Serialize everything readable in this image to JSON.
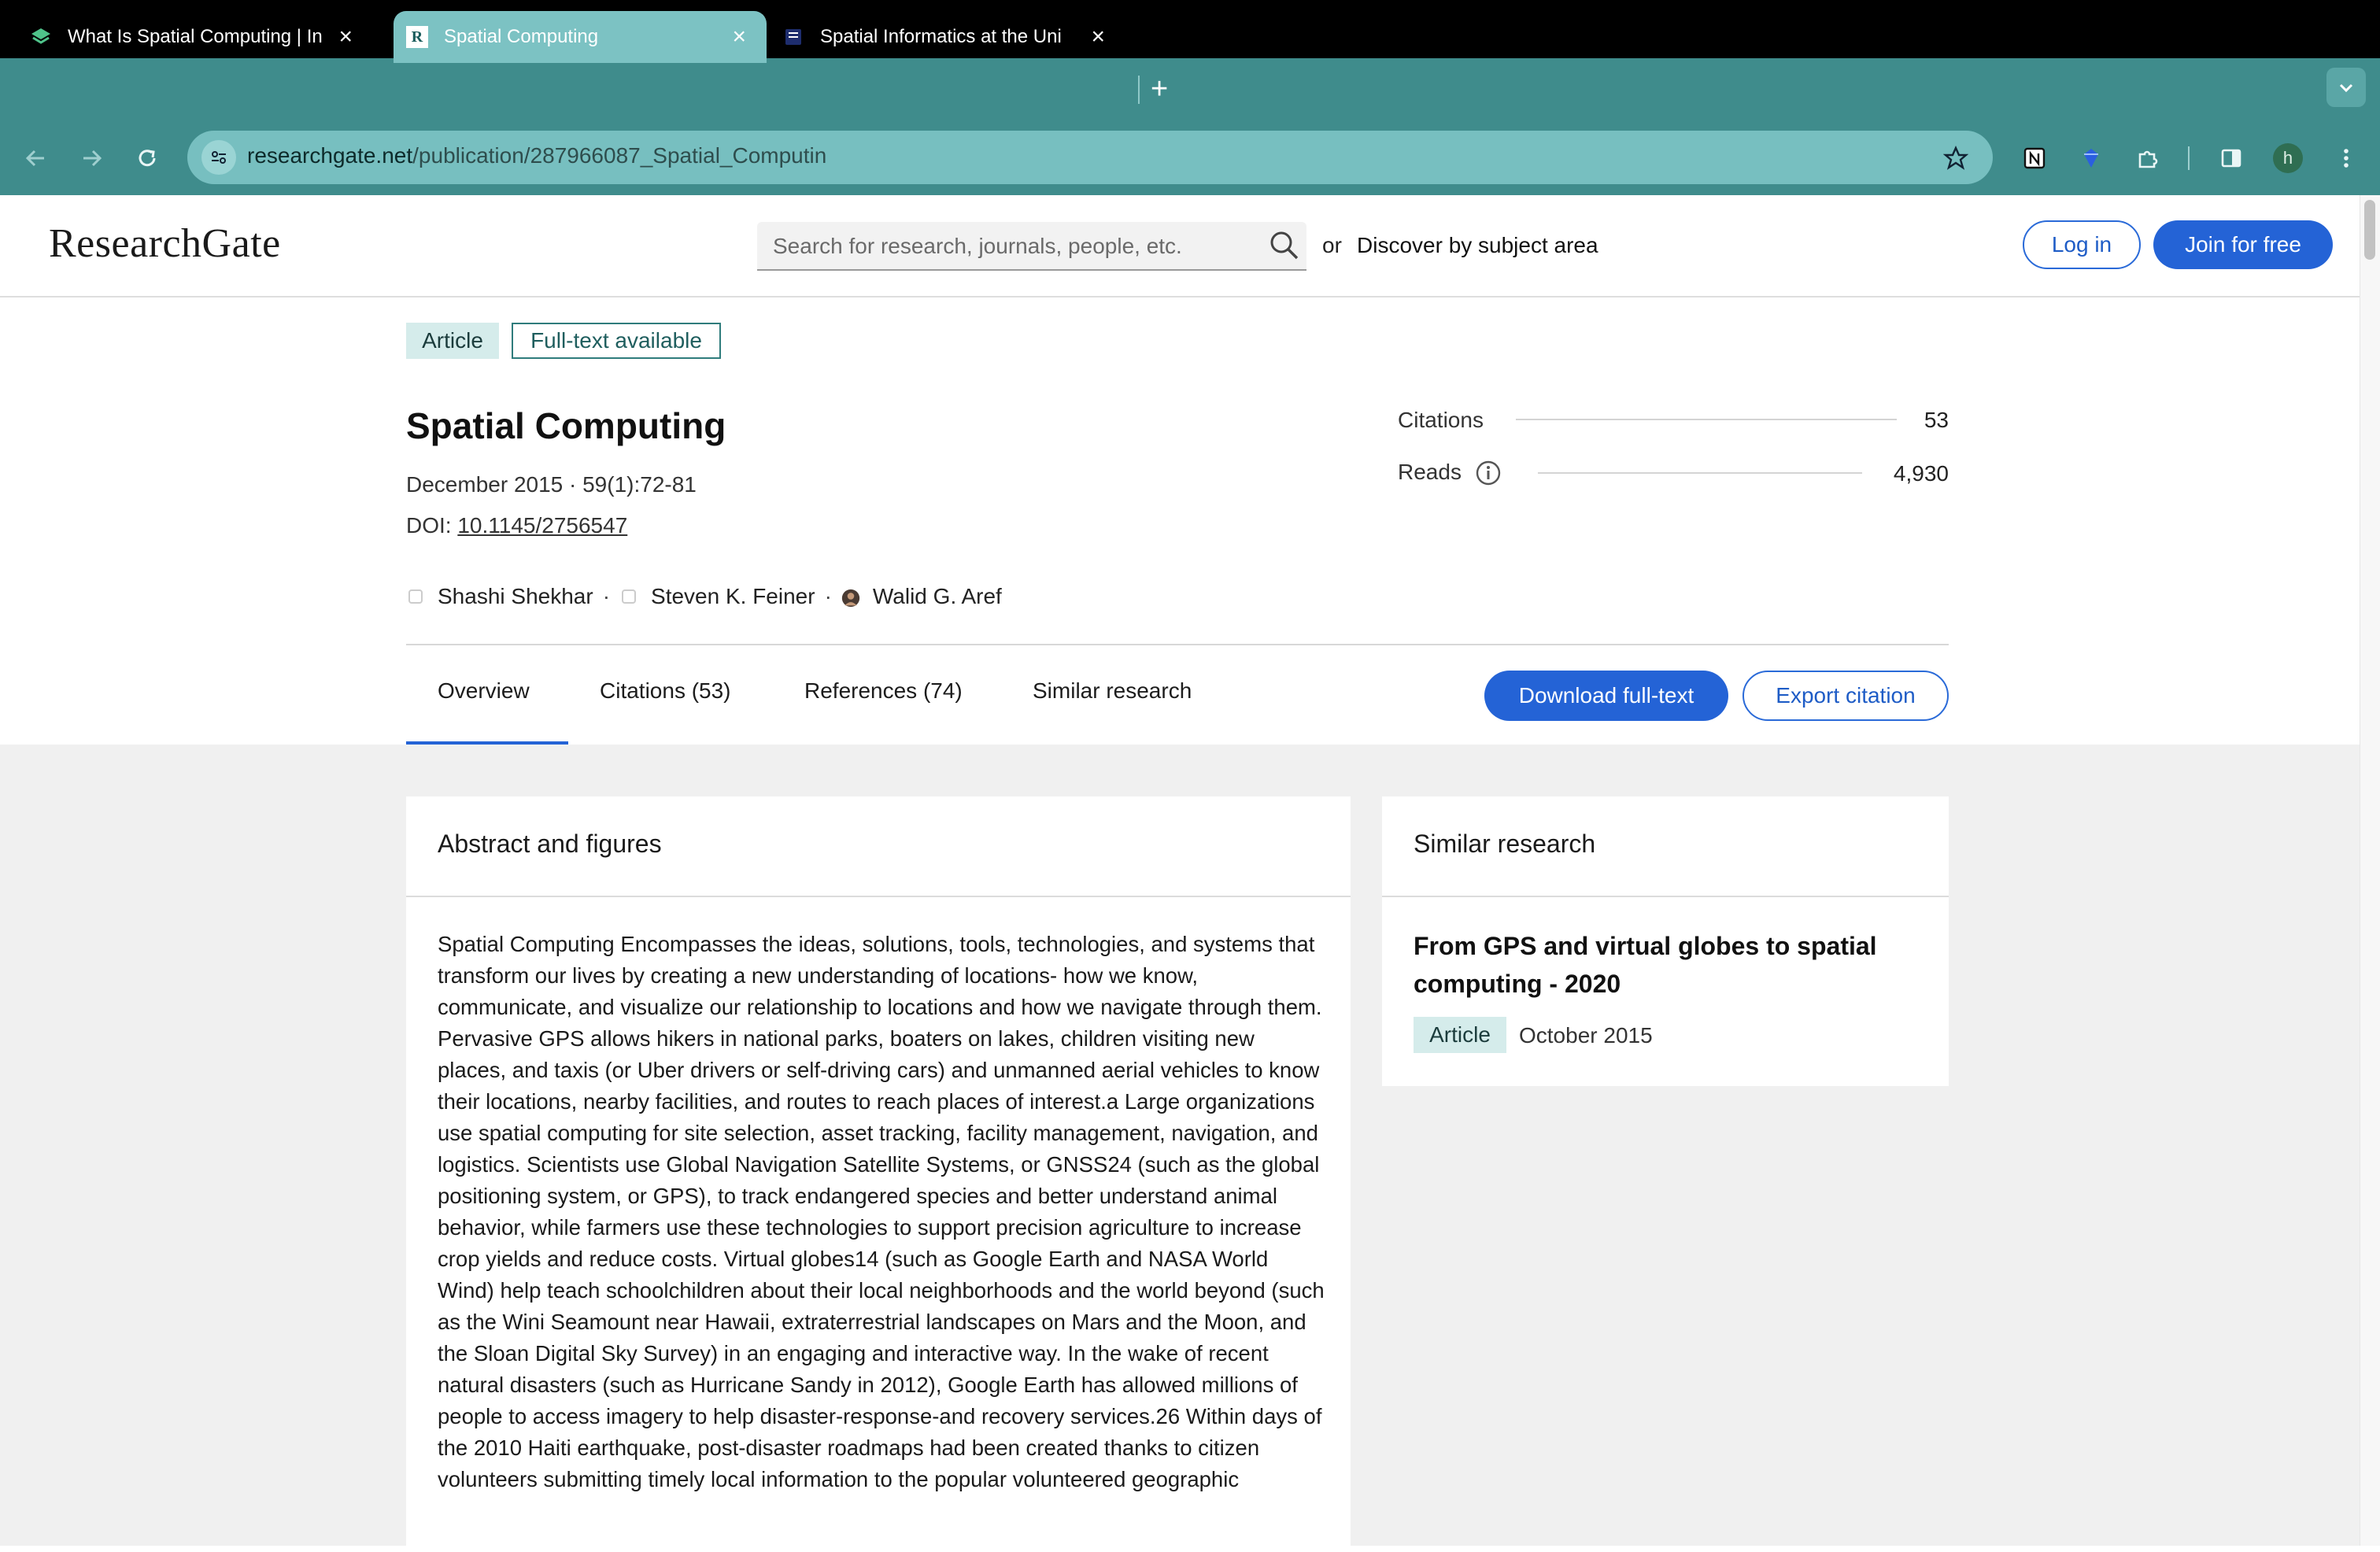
{
  "browser": {
    "tabs": [
      {
        "title": "What Is Spatial Computing | In",
        "icon": "layers-favicon"
      },
      {
        "title": "Spatial Computing",
        "icon": "researchgate-favicon",
        "active": true
      },
      {
        "title": "Spatial Informatics at the Uni",
        "icon": "book-favicon"
      }
    ],
    "new_tab": "+",
    "url_domain": "researchgate.net",
    "url_path": "/publication/287966087_Spatial_Computin",
    "profile_initial": "h"
  },
  "header": {
    "logo": "ResearchGate",
    "search_placeholder": "Search for research, journals, people, etc.",
    "or_text": "or",
    "discover_link": "Discover by subject area",
    "login": "Log in",
    "join": "Join for free"
  },
  "publication": {
    "type_badge": "Article",
    "fulltext_badge": "Full-text available",
    "title": "Spatial Computing",
    "date_line": "December 2015 · 59(1):72-81",
    "doi_label": "DOI:",
    "doi_value": "10.1145/2756547",
    "authors": [
      "Shashi Shekhar",
      "Steven K. Feiner",
      "Walid G. Aref"
    ],
    "author_sep": "·",
    "stats": [
      {
        "label": "Citations",
        "value": "53"
      },
      {
        "label": "Reads",
        "value": "4,930"
      }
    ]
  },
  "tabs": [
    "Overview",
    "Citations (53)",
    "References (74)",
    "Similar research"
  ],
  "actions": {
    "download": "Download full-text",
    "export": "Export citation"
  },
  "abstract": {
    "heading": "Abstract and figures",
    "text": "Spatial Computing Encompasses the ideas, solutions, tools, technologies, and systems that transform our lives by creating a new understanding of locations- how we know, communicate, and visualize our relationship to locations and how we navigate through them. Pervasive GPS allows hikers in national parks, boaters on lakes, children visiting new places, and taxis (or Uber drivers or self-driving cars) and unmanned aerial vehicles to know their locations, nearby facilities, and routes to reach places of interest.a Large organizations use spatial computing for site selection, asset tracking, facility management, navigation, and logistics. Scientists use Global Navigation Satellite Systems, or GNSS24 (such as the global positioning system, or GPS), to track endangered species and better understand animal behavior, while farmers use these technologies to support precision agriculture to increase crop yields and reduce costs. Virtual globes14 (such as Google Earth and NASA World Wind) help teach schoolchildren about their local neighborhoods and the world beyond (such as the Wini Seamount near Hawaii, extraterrestrial landscapes on Mars and the Moon, and the Sloan Digital Sky Survey) in an engaging and interactive way. In the wake of recent natural disasters (such as Hurricane Sandy in 2012), Google Earth has allowed millions of people to access imagery to help disaster-response-and recovery services.26 Within days of the 2010 Haiti earthquake, post-disaster roadmaps had been created thanks to citizen volunteers submitting timely local information to the popular volunteered geographic"
  },
  "similar": {
    "heading": "Similar research",
    "item_title": "From GPS and virtual globes to spatial computing - 2020",
    "item_badge": "Article",
    "item_date": "October 2015"
  },
  "colors": {
    "chrome_teal": "#3f8c8c",
    "active_tab": "#7cc2c3",
    "rg_blue": "#2463d6",
    "badge_teal": "#d5eceb",
    "body_gray": "#f0f0f0"
  }
}
